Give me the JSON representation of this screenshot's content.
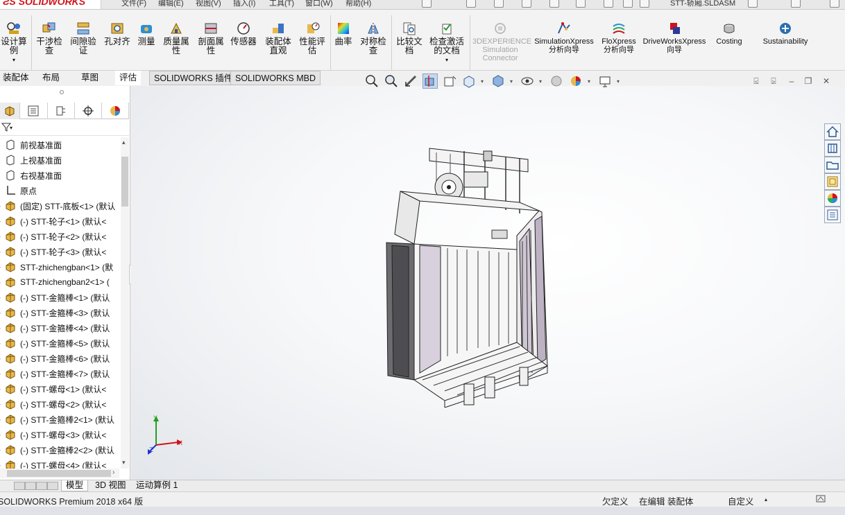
{
  "app": {
    "logo_text": "SOLIDWORKS",
    "doc_title": "STT-轿厢.SLDASM",
    "product": "SOLIDWORKS Premium 2018 x64 版"
  },
  "menu": [
    "文件(F)",
    "编辑(E)",
    "视图(V)",
    "插入(I)",
    "工具(T)",
    "窗口(W)",
    "帮助(H)"
  ],
  "ribbon": {
    "buttons": [
      {
        "label": "设计算例",
        "icon": "design-study-icon"
      },
      {
        "label": "干涉检查",
        "icon": "interference-icon"
      },
      {
        "label": "间隙验证",
        "icon": "clearance-icon"
      },
      {
        "label": "孔对齐",
        "icon": "hole-alignment-icon"
      },
      {
        "label": "测量",
        "icon": "measure-icon"
      },
      {
        "label": "质量属性",
        "icon": "mass-properties-icon"
      },
      {
        "label": "剖面属性",
        "icon": "section-properties-icon"
      },
      {
        "label": "传感器",
        "icon": "sensor-icon"
      },
      {
        "label": "装配体直观",
        "icon": "assembly-visualization-icon"
      },
      {
        "label": "性能评估",
        "icon": "performance-icon"
      },
      {
        "label": "曲率",
        "icon": "curvature-icon"
      },
      {
        "label": "对称检查",
        "icon": "symmetry-icon"
      },
      {
        "label": "比较文档",
        "icon": "compare-icon"
      },
      {
        "label": "检查激活的文档",
        "icon": "check-icon"
      },
      {
        "label": "3DEXPERIENCE Simulation Connector",
        "icon": "3dx-icon"
      },
      {
        "label": "SimulationXpress 分析向导",
        "icon": "simxpress-icon"
      },
      {
        "label": "FloXpress 分析向导",
        "icon": "floxpress-icon"
      },
      {
        "label": "DriveWorksXpress 向导",
        "icon": "driveworks-icon"
      },
      {
        "label": "Costing",
        "icon": "costing-icon"
      },
      {
        "label": "Sustainability",
        "icon": "sustainability-icon"
      }
    ]
  },
  "tabs": [
    "装配体",
    "布局",
    "草图",
    "评估",
    "SOLIDWORKS 插件",
    "SOLIDWORKS MBD"
  ],
  "active_tab": "评估",
  "tree": [
    {
      "label": "前视基准面",
      "icon": "plane-icon"
    },
    {
      "label": "上视基准面",
      "icon": "plane-icon"
    },
    {
      "label": "右视基准面",
      "icon": "plane-icon"
    },
    {
      "label": "原点",
      "icon": "origin-icon"
    },
    {
      "label": "(固定) STT-底板<1> (默认",
      "icon": "part-icon"
    },
    {
      "label": "(-) STT-轮子<1> (默认<",
      "icon": "part-icon"
    },
    {
      "label": "(-) STT-轮子<2> (默认<",
      "icon": "part-icon"
    },
    {
      "label": "(-) STT-轮子<3> (默认<",
      "icon": "part-icon"
    },
    {
      "label": "STT-zhichengban<1> (默",
      "icon": "part-icon"
    },
    {
      "label": "STT-zhichengban2<1> (",
      "icon": "part-icon"
    },
    {
      "label": "(-) STT-金箍棒<1> (默认",
      "icon": "part-icon"
    },
    {
      "label": "(-) STT-金箍棒<3> (默认",
      "icon": "part-icon"
    },
    {
      "label": "(-) STT-金箍棒<4> (默认",
      "icon": "part-icon"
    },
    {
      "label": "(-) STT-金箍棒<5> (默认",
      "icon": "part-icon"
    },
    {
      "label": "(-) STT-金箍棒<6> (默认",
      "icon": "part-icon"
    },
    {
      "label": "(-) STT-金箍棒<7> (默认",
      "icon": "part-icon"
    },
    {
      "label": "(-) STT-螺母<1> (默认<",
      "icon": "part-icon"
    },
    {
      "label": "(-) STT-螺母<2> (默认<",
      "icon": "part-icon"
    },
    {
      "label": "(-) STT-金箍棒2<1> (默认",
      "icon": "part-icon"
    },
    {
      "label": "(-) STT-螺母<3> (默认<",
      "icon": "part-icon"
    },
    {
      "label": "(-) STT-金箍棒2<2> (默认",
      "icon": "part-icon"
    },
    {
      "label": "(-) STT-螺母<4> (默认<",
      "icon": "part-icon"
    }
  ],
  "bottom_tabs": [
    "模型",
    "3D 视图",
    "运动算例 1"
  ],
  "status": {
    "underdefined": "欠定义",
    "editing": "在编辑 装配体",
    "units": "自定义"
  },
  "axes": {
    "x": "X",
    "y": "Y",
    "z": "Z"
  },
  "colors": {
    "accent": "#d0121a",
    "viewport_bg": "#f4f5f7"
  }
}
